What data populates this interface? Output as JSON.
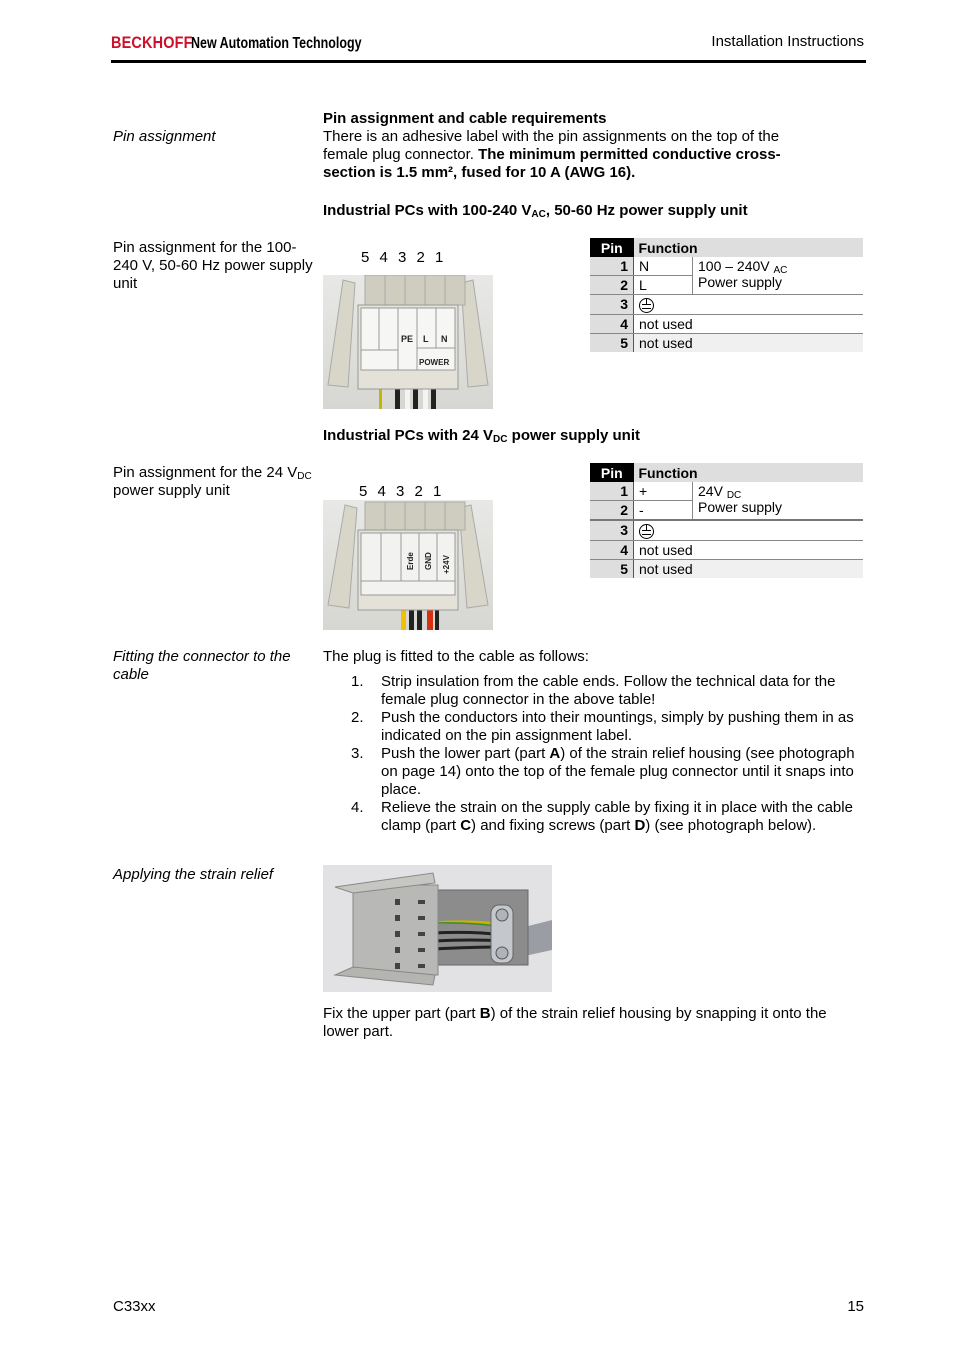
{
  "header": {
    "brand": "BECKHOFF",
    "tagline": "New Automation Technology",
    "section": "Installation Instructions",
    "brand_color": "#d0102a"
  },
  "pin_section": {
    "side_label": "Pin assignment",
    "title": "Pin assignment and cable requirements",
    "intro_normal": "There is an adhesive label with the pin assignments on the top of the female plug connector. ",
    "intro_bold": "The minimum permitted conductive cross-section is 1.5 mm², fused for 10 A (AWG 16)."
  },
  "ac_unit": {
    "heading_pre": "Industrial PCs with 100-240 V",
    "heading_sub": "AC",
    "heading_post": ", 50-60 Hz power supply unit",
    "side_label": "Pin assignment for the 100-240 V, 50-60 Hz power supply unit",
    "pin_numbers": "5 4 3 2 1",
    "photo_labels": [
      "PE",
      "L",
      "N",
      "POWER"
    ],
    "table": {
      "header_pin": "Pin",
      "header_function": "Function",
      "rows": [
        {
          "pin": "1",
          "signal": "N"
        },
        {
          "pin": "2",
          "signal": "L"
        },
        {
          "pin": "3",
          "signal": "earth-ground-icon"
        },
        {
          "pin": "4",
          "signal": "not used"
        },
        {
          "pin": "5",
          "signal": "not used"
        }
      ],
      "group_value": "100 – 240V",
      "group_sub": "AC",
      "group_desc": "Power supply"
    }
  },
  "dc_unit": {
    "heading_pre": "Industrial PCs with 24 V",
    "heading_sub": "DC",
    "heading_post": " power supply unit",
    "side_label_pre": "Pin assignment for the 24 V",
    "side_label_sub": "DC",
    "side_label_post": " power supply unit",
    "pin_numbers": "5 4 3 2 1",
    "photo_labels": [
      "Erde",
      "GND",
      "+24V"
    ],
    "table": {
      "header_pin": "Pin",
      "header_function": "Function",
      "rows": [
        {
          "pin": "1",
          "signal": "+"
        },
        {
          "pin": "2",
          "signal": "-"
        },
        {
          "pin": "3",
          "signal": "earth-ground-icon"
        },
        {
          "pin": "4",
          "signal": "not used"
        },
        {
          "pin": "5",
          "signal": "not used"
        }
      ],
      "group_value": "24V",
      "group_sub": "DC",
      "group_desc": "Power supply"
    }
  },
  "fitting": {
    "side_label": "Fitting the connector to the cable",
    "intro": "The plug is fitted to the cable as follows:",
    "steps": [
      {
        "num": "1.",
        "parts": [
          {
            "t": "Strip insulation from the cable ends. Follow the technical data for the female plug connector in the above table!"
          }
        ]
      },
      {
        "num": "2.",
        "parts": [
          {
            "t": "Push the conductors into their mountings, simply by pushing them in as indicated on the pin assignment label."
          }
        ]
      },
      {
        "num": "3.",
        "parts": [
          {
            "t": "Push the lower part (part "
          },
          {
            "t": "A",
            "b": true
          },
          {
            "t": ") of the strain relief housing (see photograph on page 14) onto the top of the female plug connector until it snaps into place."
          }
        ]
      },
      {
        "num": "4.",
        "parts": [
          {
            "t": "Relieve the strain on the supply cable by fixing it in place with the cable clamp (part "
          },
          {
            "t": "C",
            "b": true
          },
          {
            "t": ") and fixing screws (part "
          },
          {
            "t": "D",
            "b": true
          },
          {
            "t": ") (see photograph below)."
          }
        ]
      }
    ]
  },
  "strain_relief": {
    "side_label": "Applying the strain relief",
    "text_pre": "Fix the upper part (part ",
    "text_bold": "B",
    "text_post": ") of the strain relief housing by snapping it onto the lower part."
  },
  "footer": {
    "product": "C33xx",
    "page": "15"
  }
}
